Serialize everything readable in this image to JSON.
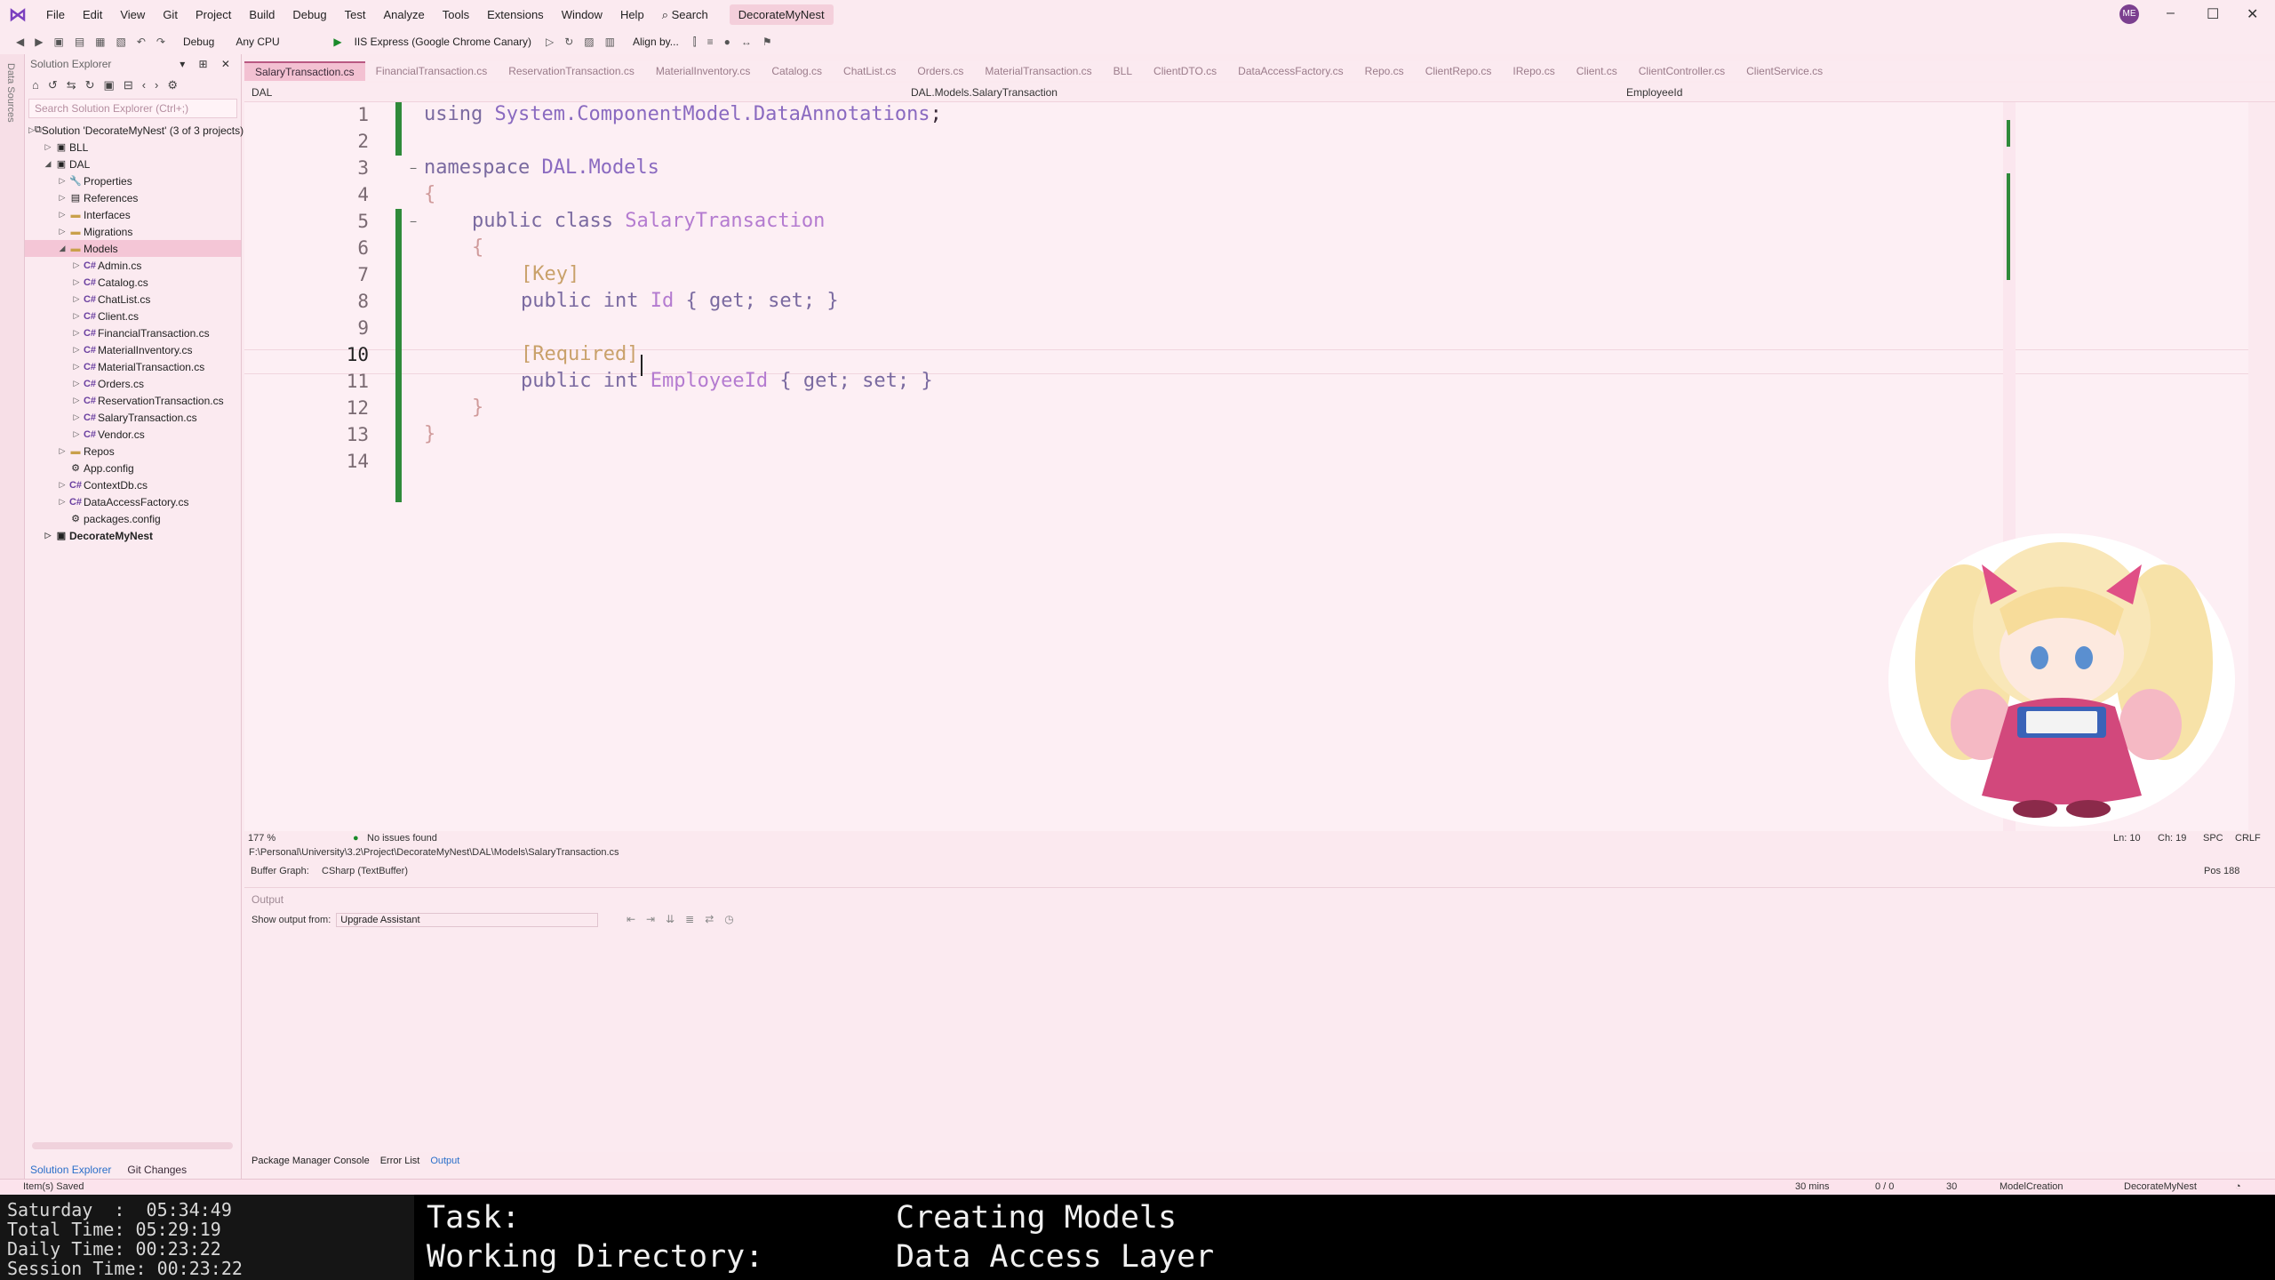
{
  "menu": {
    "items": [
      "File",
      "Edit",
      "View",
      "Git",
      "Project",
      "Build",
      "Debug",
      "Test",
      "Analyze",
      "Tools",
      "Extensions",
      "Window",
      "Help"
    ],
    "search_label": "Search",
    "solution_name": "DecorateMyNest",
    "avatar_initials": "ME"
  },
  "toolbar": {
    "config": "Debug",
    "platform": "Any CPU",
    "run_target": "IIS Express (Google Chrome Canary)",
    "align_label": "Align by..."
  },
  "left_strip": {
    "label": "Data Sources"
  },
  "solution_explorer": {
    "title": "Solution Explorer",
    "search_placeholder": "Search Solution Explorer (Ctrl+;)",
    "items": [
      {
        "label": "Solution 'DecorateMyNest' (3 of 3 projects)",
        "indent": 0,
        "type": "solution"
      },
      {
        "label": "BLL",
        "indent": 1,
        "type": "project"
      },
      {
        "label": "DAL",
        "indent": 1,
        "type": "project"
      },
      {
        "label": "Properties",
        "indent": 2,
        "type": "props"
      },
      {
        "label": "References",
        "indent": 2,
        "type": "refs"
      },
      {
        "label": "Interfaces",
        "indent": 2,
        "type": "folder"
      },
      {
        "label": "Migrations",
        "indent": 2,
        "type": "folder"
      },
      {
        "label": "Models",
        "indent": 2,
        "type": "folder"
      },
      {
        "label": "Admin.cs",
        "indent": 3,
        "type": "cs"
      },
      {
        "label": "Catalog.cs",
        "indent": 3,
        "type": "cs"
      },
      {
        "label": "ChatList.cs",
        "indent": 3,
        "type": "cs"
      },
      {
        "label": "Client.cs",
        "indent": 3,
        "type": "cs"
      },
      {
        "label": "FinancialTransaction.cs",
        "indent": 3,
        "type": "cs"
      },
      {
        "label": "MaterialInventory.cs",
        "indent": 3,
        "type": "cs"
      },
      {
        "label": "MaterialTransaction.cs",
        "indent": 3,
        "type": "cs"
      },
      {
        "label": "Orders.cs",
        "indent": 3,
        "type": "cs"
      },
      {
        "label": "ReservationTransaction.cs",
        "indent": 3,
        "type": "cs"
      },
      {
        "label": "SalaryTransaction.cs",
        "indent": 3,
        "type": "cs"
      },
      {
        "label": "Vendor.cs",
        "indent": 3,
        "type": "cs"
      },
      {
        "label": "Repos",
        "indent": 2,
        "type": "folder"
      },
      {
        "label": "App.config",
        "indent": 2,
        "type": "config"
      },
      {
        "label": "ContextDb.cs",
        "indent": 2,
        "type": "cs"
      },
      {
        "label": "DataAccessFactory.cs",
        "indent": 2,
        "type": "cs"
      },
      {
        "label": "packages.config",
        "indent": 2,
        "type": "config"
      },
      {
        "label": "DecorateMyNest",
        "indent": 1,
        "type": "project"
      }
    ],
    "bottom_tabs": [
      "Solution Explorer",
      "Git Changes"
    ]
  },
  "editor": {
    "tabs": [
      "SalaryTransaction.cs",
      "FinancialTransaction.cs",
      "ReservationTransaction.cs",
      "MaterialInventory.cs",
      "Catalog.cs",
      "ChatList.cs",
      "Orders.cs",
      "MaterialTransaction.cs",
      "BLL",
      "ClientDTO.cs",
      "DataAccessFactory.cs",
      "Repo.cs",
      "ClientRepo.cs",
      "IRepo.cs",
      "Client.cs",
      "ClientController.cs",
      "ClientService.cs"
    ],
    "nav_project": "DAL",
    "nav_class": "DAL.Models.SalaryTransaction",
    "nav_member": "EmployeeId",
    "line_numbers": [
      "1",
      "2",
      "3",
      "4",
      "5",
      "6",
      "7",
      "8",
      "9",
      "10",
      "11",
      "12",
      "13",
      "14"
    ],
    "lines": {
      "l1_kw": "using",
      "l1_ns": "System.ComponentModel.DataAnnotations",
      "l1_semi": ";",
      "l3_kw": "namespace",
      "l3_ns": "DAL.Models",
      "l4": "{",
      "l5_kw": "public class",
      "l5_cls": "SalaryTransaction",
      "l6": "{",
      "l7": "[Key]",
      "l8_kw": "public int",
      "l8_id": "Id",
      "l8_acc": "{ get; set; }",
      "l10": "[Required]",
      "l11_kw": "public int",
      "l11_id": "EmployeeId",
      "l11_acc": "{ get; set; }",
      "l12": "}",
      "l13": "}"
    },
    "zoom": "177 %",
    "issues": "No issues found",
    "ln": "Ln: 10",
    "ch": "Ch: 19",
    "spc": "SPC",
    "eol": "CRLF",
    "file_path": "F:\\Personal\\University\\3.2\\Project\\DecorateMyNest\\DAL\\Models\\SalaryTransaction.cs",
    "buffer_label": "Buffer Graph:",
    "buffer_value": "CSharp (TextBuffer)",
    "pos": "Pos 188"
  },
  "output": {
    "title": "Output",
    "show_from_label": "Show output from:",
    "show_from_value": "Upgrade Assistant",
    "tabs": [
      "Package Manager Console",
      "Error List",
      "Output"
    ]
  },
  "statusbar": {
    "message": "Item(s) Saved",
    "time": "30 mins",
    "changes": "0 / 0",
    "edits": "30",
    "branch": "ModelCreation",
    "repo": "DecorateMyNest"
  },
  "overlay": {
    "timer_text": "Saturday  :  05:34:49\nTotal Time: 05:29:19\nDaily Time: 00:23:22\nSession Time: 00:23:22",
    "task_label": "Task:",
    "task_value": "Creating Models",
    "dir_label": "Working Directory:",
    "dir_value": "Data Access Layer"
  },
  "colors": {
    "accent": "#b95882",
    "change_bar": "#2f8a3a",
    "background": "#fbe9ef"
  }
}
